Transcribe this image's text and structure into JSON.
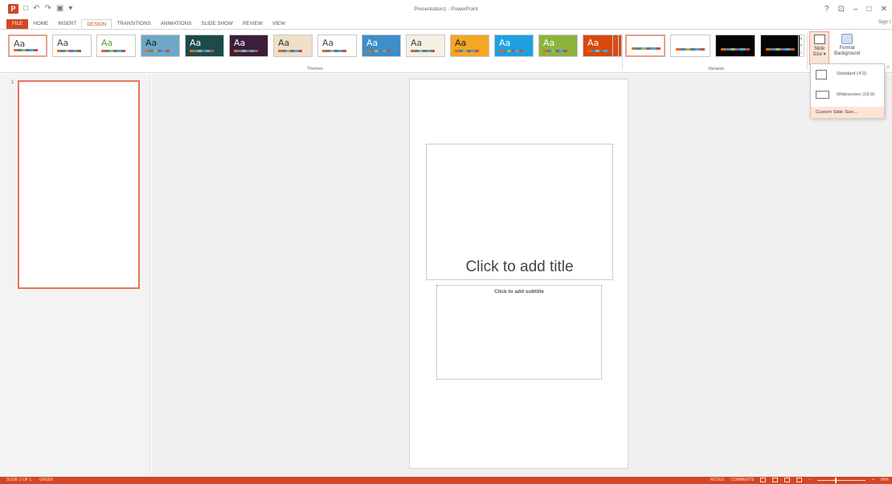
{
  "window": {
    "title": "Presentation1 - PowerPoint",
    "sign_in": "Sign i",
    "controls": {
      "help": "?",
      "restore_ribbon": "⊡",
      "minimize": "–",
      "restore": "🗗",
      "close": "✕"
    }
  },
  "qat": {
    "logo": "P",
    "undo": "↶",
    "redo": "↷",
    "customize": "▾"
  },
  "tabs": [
    "FILE",
    "HOME",
    "INSERT",
    "DESIGN",
    "TRANSITIONS",
    "ANIMATIONS",
    "SLIDE SHOW",
    "REVIEW",
    "VIEW"
  ],
  "active_tab": "DESIGN",
  "ribbon": {
    "themes_label": "Themes",
    "variants_label": "Variants",
    "theme_text": "Aa",
    "themes": [
      {
        "bg": "#ffffff",
        "fg": "#444444"
      },
      {
        "bg": "#ffffff",
        "fg": "#444444"
      },
      {
        "bg": "#ffffff",
        "fg": "#5aa02c"
      },
      {
        "bg": "#6ca8c8",
        "fg": "#222222"
      },
      {
        "bg": "#1d4a4a",
        "fg": "#ffffff"
      },
      {
        "bg": "#3b1e3a",
        "fg": "#ffffff"
      },
      {
        "bg": "#f0e0c8",
        "fg": "#333333"
      },
      {
        "bg": "#ffffff",
        "fg": "#444444"
      },
      {
        "bg": "#3d8ec9",
        "fg": "#ffffff"
      },
      {
        "bg": "#f4f1e4",
        "fg": "#444444"
      },
      {
        "bg": "#f5a623",
        "fg": "#222222"
      },
      {
        "bg": "#1ea1e2",
        "fg": "#ffffff"
      },
      {
        "bg": "#8cb43c",
        "fg": "#ffffff"
      },
      {
        "bg": "#d9480f",
        "fg": "#ffffff"
      }
    ],
    "slide_size": "Slide Size ▾",
    "format_background": "Format Background",
    "collapse": "^"
  },
  "dropdown": {
    "standard": "Standard (4:3)",
    "widescreen": "Widescreen (16:9)",
    "custom": "Custom Slide Size..."
  },
  "thumbpane": {
    "slide_number": "1"
  },
  "slide": {
    "title_placeholder": "Click to add title",
    "subtitle_placeholder": "Click to add subtitle"
  },
  "statusbar": {
    "slide_info": "SLIDE 1 OF 1",
    "language": "GREEK",
    "notes": "NOTES",
    "comments": "COMMENTS",
    "zoom": "66%"
  },
  "colors": {
    "accent": "#d24726",
    "selection": "#e8735a",
    "hover": "#fce4d6"
  }
}
